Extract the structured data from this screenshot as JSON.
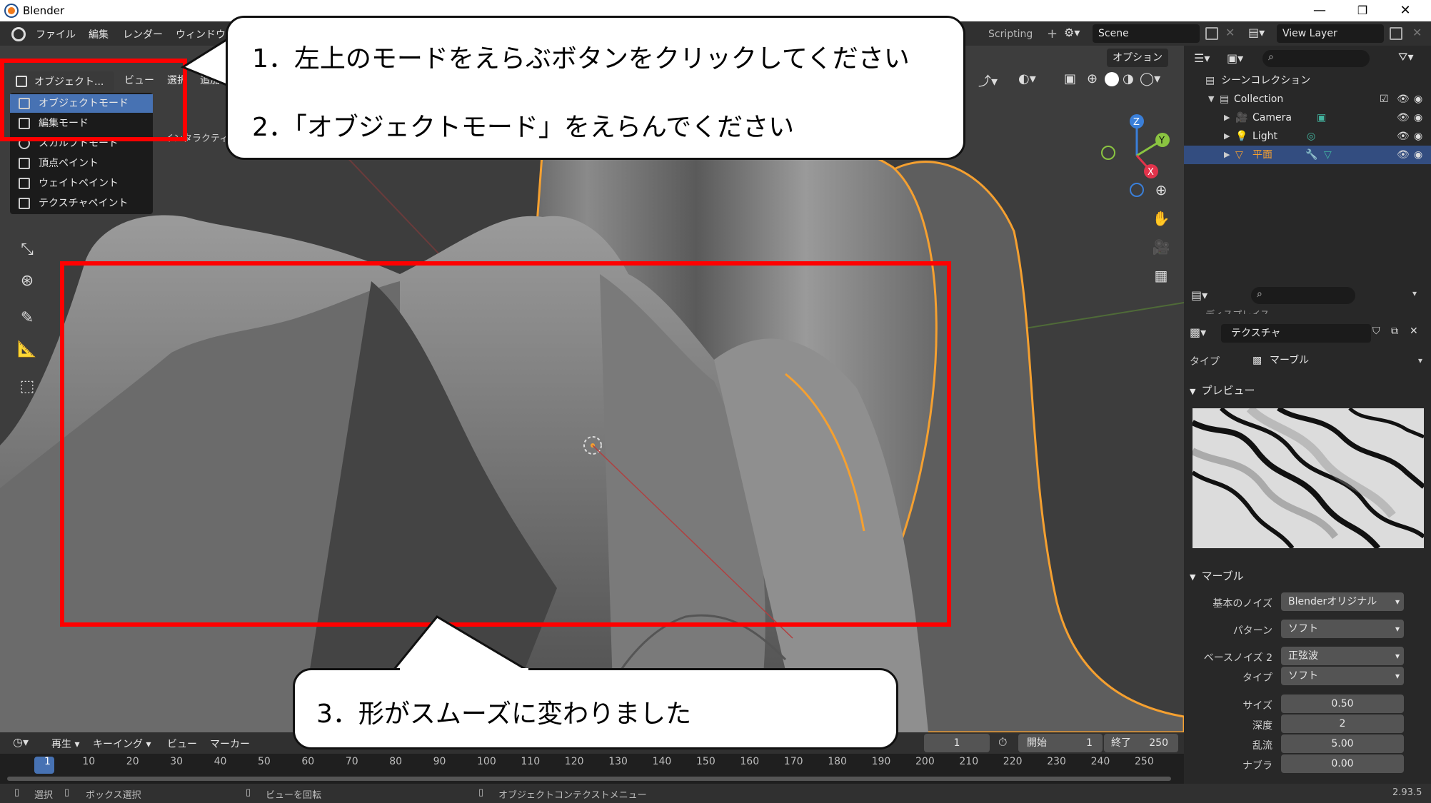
{
  "window": {
    "title": "Blender",
    "controls": [
      "—",
      "❐",
      "✕"
    ]
  },
  "menubar": {
    "items": [
      "ファイル",
      "編集",
      "レンダー",
      "ウィンドウ"
    ],
    "workspace_tab": "Scripting",
    "add_tab": "+",
    "scene": "Scene",
    "view_layer": "View Layer"
  },
  "viewport_header": {
    "mode_button": "オブジェクト...",
    "menus": [
      "ビュー",
      "選択",
      "追加"
    ],
    "options_button": "オプション",
    "partial_label": "インタラクティブ対話モード"
  },
  "mode_menu": {
    "items": [
      {
        "label": "オブジェクトモード",
        "selected": true
      },
      {
        "label": "編集モード",
        "selected": false
      },
      {
        "label": "スカルプトモード",
        "selected": false
      },
      {
        "label": "頂点ペイント",
        "selected": false
      },
      {
        "label": "ウェイトペイント",
        "selected": false
      },
      {
        "label": "テクスチャペイント",
        "selected": false
      }
    ]
  },
  "gizmo": {
    "z": "Z",
    "y": "Y",
    "x": "X"
  },
  "outliner": {
    "root": "シーンコレクション",
    "rows": [
      {
        "label": "Collection"
      },
      {
        "label": "Camera"
      },
      {
        "label": "Light"
      },
      {
        "label": "平面",
        "selected": true
      }
    ]
  },
  "properties": {
    "partial_header": "ディスプレイス",
    "texture_name": "テクスチャ",
    "type_label": "タイプ",
    "type_value": "マーブル",
    "preview_header": "プレビュー",
    "marble_header": "マーブル",
    "fields": [
      {
        "label": "基本のノイズ",
        "value": "Blenderオリジナル"
      },
      {
        "label": "パターン",
        "value": "ソフト"
      },
      {
        "label": "ベースノイズ 2",
        "value": "正弦波"
      },
      {
        "label": "タイプ",
        "value": "ソフト"
      }
    ],
    "numbers": [
      {
        "label": "サイズ",
        "value": "0.50"
      },
      {
        "label": "深度",
        "value": "2"
      },
      {
        "label": "乱流",
        "value": "5.00"
      },
      {
        "label": "ナブラ",
        "value": "0.00"
      }
    ]
  },
  "timeline": {
    "menus": [
      "再生",
      "キーイング",
      "ビュー",
      "マーカー"
    ],
    "current_frame": "1",
    "start_label": "開始",
    "start_value": "1",
    "end_label": "終了",
    "end_value": "250",
    "ticks": [
      "1",
      "10",
      "20",
      "30",
      "40",
      "50",
      "60",
      "70",
      "80",
      "90",
      "100",
      "110",
      "120",
      "130",
      "140",
      "150",
      "160",
      "170",
      "180",
      "190",
      "200",
      "210",
      "220",
      "230",
      "240",
      "250"
    ]
  },
  "statusbar": {
    "select": "選択",
    "box_select": "ボックス選択",
    "rotate_view": "ビューを回転",
    "context_menu": "オブジェクトコンテクストメニュー",
    "version": "2.93.5"
  },
  "callouts": {
    "top_line1": "1．左上のモードをえらぶボタンをクリックしてください",
    "top_line2": "2．「オブジェクトモード」をえらんでください",
    "bottom": "3．形がスムーズに変わりました"
  },
  "colors": {
    "highlight": "#ff0000",
    "selection": "#4772b3",
    "object_outline": "#f5a030"
  }
}
